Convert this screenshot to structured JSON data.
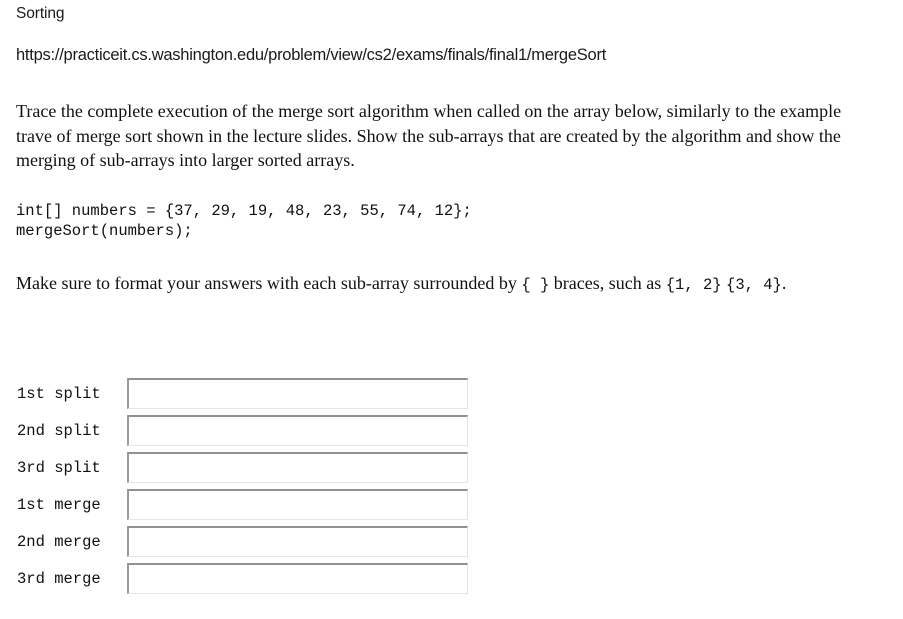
{
  "problem": {
    "title": "Sorting",
    "url": "https://practiceit.cs.washington.edu/problem/view/cs2/exams/finals/final1/mergeSort",
    "description": "Trace the complete execution of the merge sort algorithm when called on the array below, similarly to the example trave of merge sort shown in the lecture slides. Show the sub-arrays that are created by the algorithm and show the merging of sub-arrays into larger sorted arrays.",
    "code": "int[] numbers = {37, 29, 19, 48, 23, 55, 74, 12};\nmergeSort(numbers);",
    "format_note": {
      "part1": "Make sure to format your answers with each sub-array surrounded by ",
      "braces": "{ }",
      "part2": " braces, such as ",
      "example1": "{1, 2}",
      "example2": "{3, 4}",
      "part3": "."
    }
  },
  "answer_form": {
    "fields": [
      {
        "label": "1st split",
        "value": "",
        "placeholder": ""
      },
      {
        "label": "2nd split",
        "value": "",
        "placeholder": ""
      },
      {
        "label": "3rd split",
        "value": "",
        "placeholder": ""
      },
      {
        "label": "1st merge",
        "value": "",
        "placeholder": ""
      },
      {
        "label": "2nd merge",
        "value": "",
        "placeholder": ""
      },
      {
        "label": "3rd merge",
        "value": "",
        "placeholder": ""
      }
    ]
  },
  "colors": {
    "background": "#ffffff",
    "text": "#111111",
    "input_border_dark": "#919191",
    "input_border_light": "#e2e2e2"
  }
}
